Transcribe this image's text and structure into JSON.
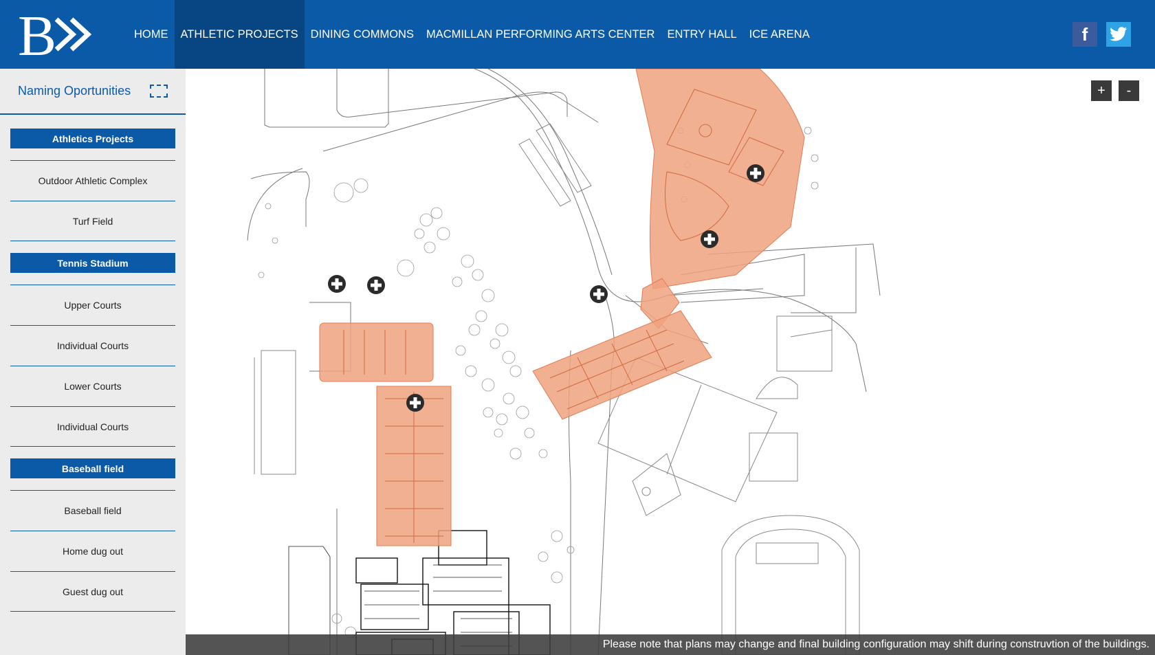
{
  "brand": {
    "logo_text": "B"
  },
  "nav": {
    "items": [
      {
        "label": "HOME"
      },
      {
        "label": "ATHLETIC PROJECTS"
      },
      {
        "label": "DINING COMMONS"
      },
      {
        "label": "MACMILLAN PERFORMING ARTS CENTER"
      },
      {
        "label": "ENTRY HALL"
      },
      {
        "label": "ICE ARENA"
      }
    ],
    "active_index": 1
  },
  "social": {
    "facebook": "f",
    "twitter_icon": "twitter-bird-icon"
  },
  "sidebar": {
    "title": "Naming Oportunities",
    "sections": [
      {
        "heading": "Athletics Projects",
        "items": [
          "Outdoor Athletic Complex",
          "Turf Field"
        ]
      },
      {
        "heading": "Tennis Stadium",
        "items": [
          "Upper Courts",
          "Individual Courts",
          "Lower Courts",
          "Individual Courts"
        ]
      },
      {
        "heading": "Baseball field",
        "items": [
          "Baseball field",
          "Home dug out",
          "Guest dug out"
        ]
      }
    ]
  },
  "map": {
    "zoom_in": "+",
    "zoom_out": "-",
    "highlight_color": "#f0a27f",
    "marker_color": "#2b2b2b",
    "marker_icon": "plus-marker-icon"
  },
  "notice": "Please note that plans may change and final building configuration may shift during construvtion of the buildings.",
  "colors": {
    "primary": "#0b5aa8",
    "primary_dark": "#074683",
    "sidebar_bg": "#ececec"
  }
}
